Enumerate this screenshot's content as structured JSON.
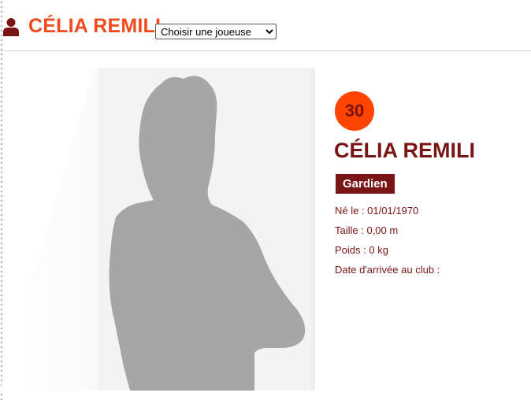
{
  "header": {
    "title": "CÉLIA REMILI",
    "user_icon": "user-icon",
    "player_select": {
      "selected": "Choisir une joueuse",
      "options": [
        "Choisir une joueuse"
      ]
    }
  },
  "player": {
    "number": "30",
    "name": "CÉLIA REMILI",
    "position": "Gardien",
    "birth": "Né le : 01/01/1970",
    "height": "Taille : 0,00 m",
    "weight": "Poids : 0 kg",
    "arrival": "Date d'arrivée au club :"
  },
  "colors": {
    "accent": "#f04a1e",
    "number_badge": "#ff4500",
    "dark_red": "#7a1515",
    "silhouette": "#a6a6a6"
  }
}
